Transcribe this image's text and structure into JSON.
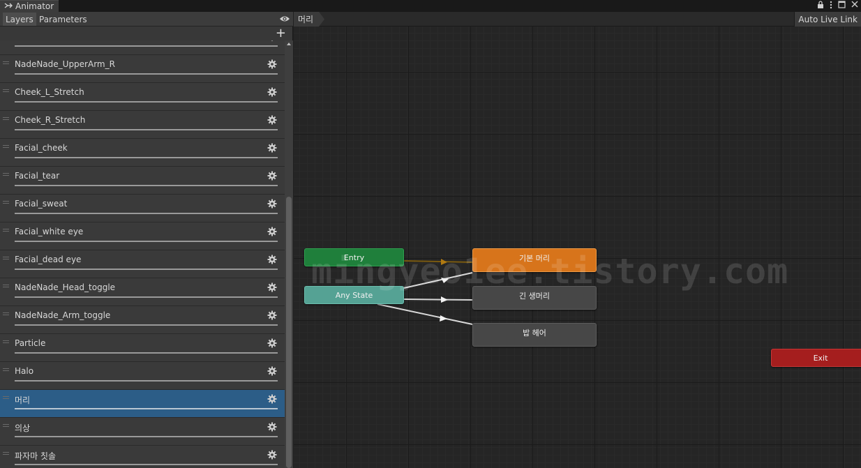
{
  "window": {
    "title": "Animator"
  },
  "tabs": {
    "layers": "Layers",
    "parameters": "Parameters"
  },
  "toolbar": {
    "add": "+"
  },
  "layers": [
    {
      "name": ""
    },
    {
      "name": "NadeNade_UpperArm_R"
    },
    {
      "name": "Cheek_L_Stretch"
    },
    {
      "name": "Cheek_R_Stretch"
    },
    {
      "name": "Facial_cheek"
    },
    {
      "name": "Facial_tear"
    },
    {
      "name": "Facial_sweat"
    },
    {
      "name": "Facial_white eye"
    },
    {
      "name": "Facial_dead eye"
    },
    {
      "name": "NadeNade_Head_toggle"
    },
    {
      "name": "NadeNade_Arm_toggle"
    },
    {
      "name": "Particle"
    },
    {
      "name": "Halo"
    },
    {
      "name": "머리",
      "selected": true
    },
    {
      "name": "의상"
    },
    {
      "name": "파자마 칫솔"
    }
  ],
  "graph": {
    "breadcrumb": "머리",
    "live_link": "Auto Live Link",
    "watermark": "mingyeo1ee.tistory.com",
    "states": {
      "entry": "Entry",
      "any_state": "Any State",
      "default_state": "기본 머리",
      "state_2": "긴 생머리",
      "state_3": "밥 헤어",
      "exit": "Exit"
    }
  },
  "icons": {
    "animator": "animator-icon",
    "eye": "eye-icon",
    "gear": "gear-icon",
    "lock": "lock-icon",
    "menu": "kebab-menu-icon",
    "maximize": "maximize-icon",
    "close": "close-icon"
  },
  "colors": {
    "selected_layer": "#2c5d87",
    "entry": "#1f7f3b",
    "any_state": "#55a294",
    "default_state": "#d7741b",
    "exit": "#a51e1e"
  }
}
